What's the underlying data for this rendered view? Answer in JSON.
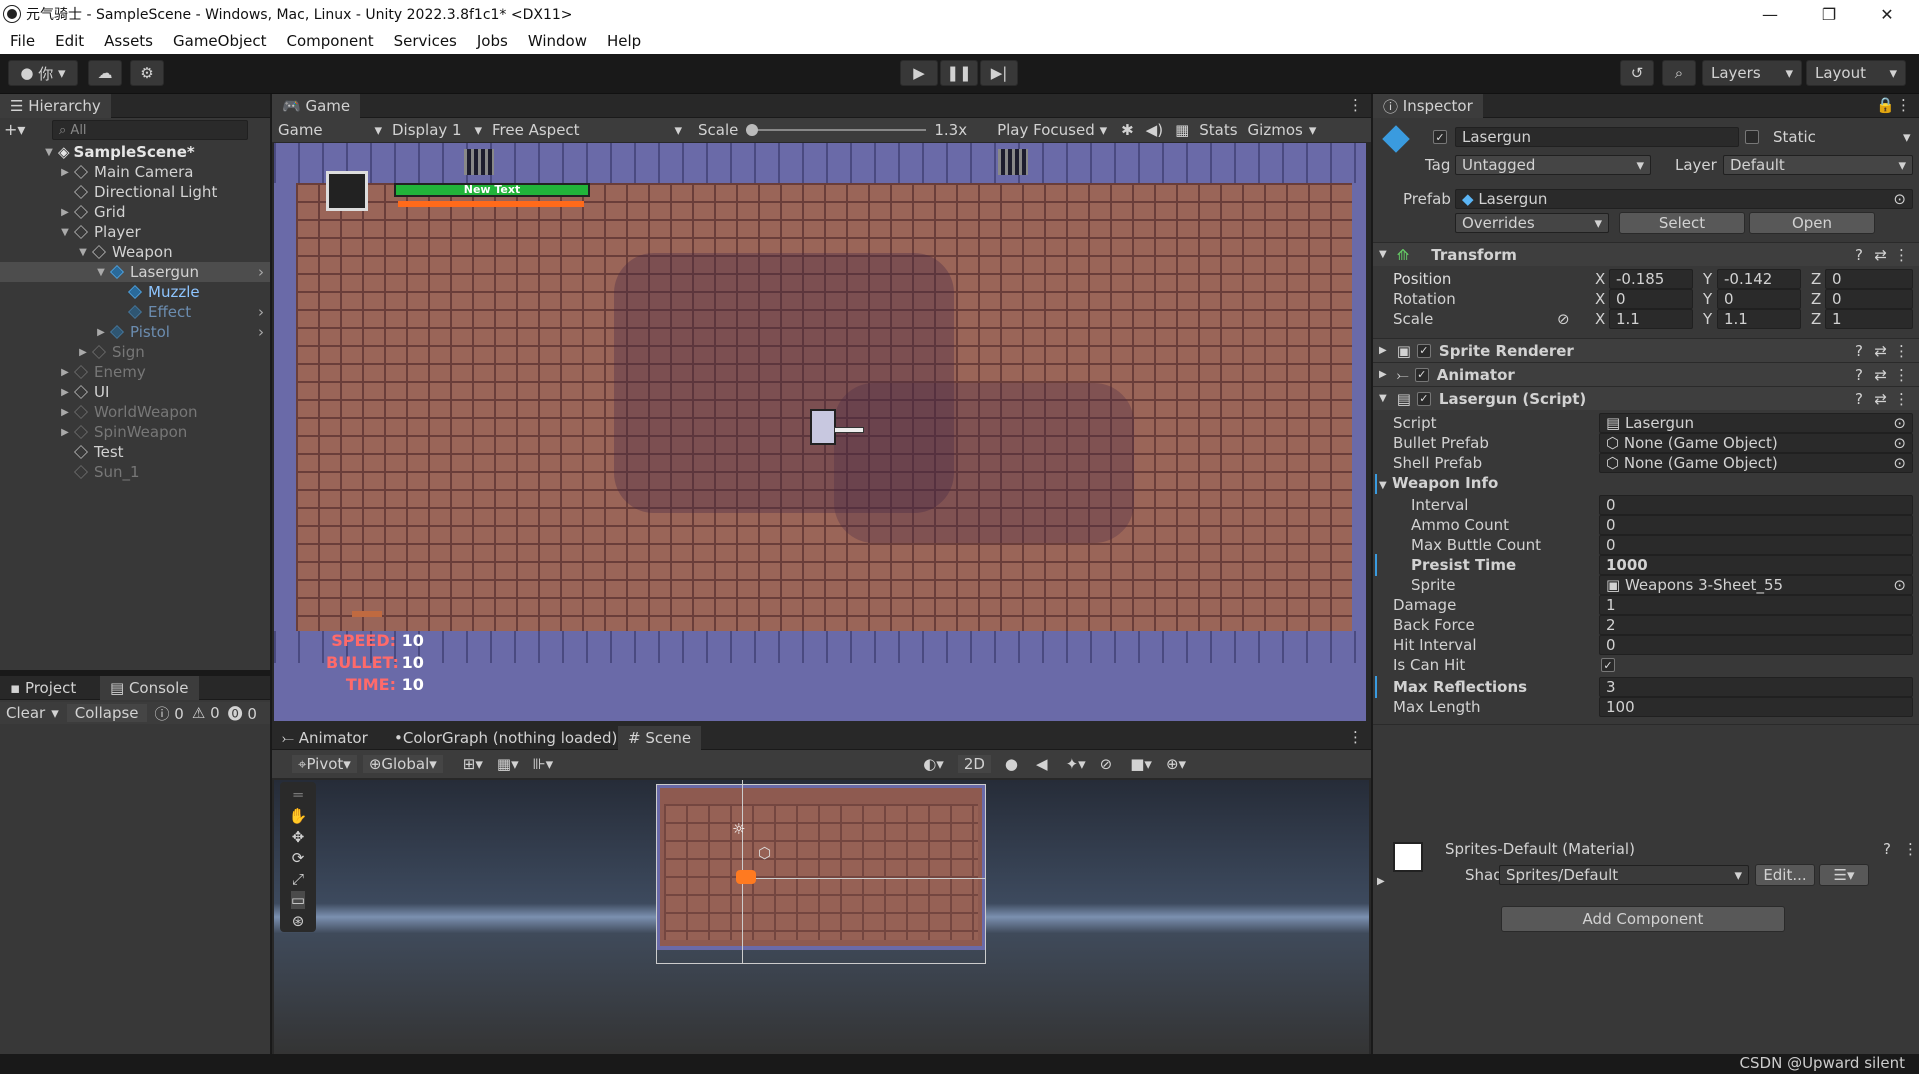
{
  "window": {
    "title": "元气骑士 - SampleScene - Windows, Mac, Linux - Unity 2022.3.8f1c1* <DX11>",
    "min": "—",
    "max": "❐",
    "close": "✕"
  },
  "menu": [
    "File",
    "Edit",
    "Assets",
    "GameObject",
    "Component",
    "Services",
    "Jobs",
    "Window",
    "Help"
  ],
  "toolbar": {
    "account": "你",
    "layers": "Layers",
    "layout": "Layout"
  },
  "hierarchy": {
    "tab": "Hierarchy",
    "search_placeholder": "All",
    "items": [
      {
        "label": "SampleScene*"
      },
      {
        "label": "Main Camera"
      },
      {
        "label": "Directional Light"
      },
      {
        "label": "Grid"
      },
      {
        "label": "Player"
      },
      {
        "label": "Weapon"
      },
      {
        "label": "Lasergun"
      },
      {
        "label": "Muzzle"
      },
      {
        "label": "Effect"
      },
      {
        "label": "Pistol"
      },
      {
        "label": "Sign"
      },
      {
        "label": "Enemy"
      },
      {
        "label": "UI"
      },
      {
        "label": "WorldWeapon"
      },
      {
        "label": "SpinWeapon"
      },
      {
        "label": "Test"
      },
      {
        "label": "Sun_1"
      }
    ]
  },
  "project": {
    "tab_project": "Project",
    "tab_console": "Console",
    "clear": "Clear",
    "collapse": "Collapse",
    "c1": "0",
    "c2": "0",
    "c3": "0"
  },
  "game": {
    "tab": "Game",
    "display_mode": "Game",
    "display": "Display 1",
    "aspect": "Free Aspect",
    "scale_label": "Scale",
    "scale_value": "1.3x",
    "play_mode": "Play Focused",
    "stats": "Stats",
    "gizmos": "Gizmos",
    "hud_text": "New Text",
    "speed_label": "SPEED:",
    "speed_value": "10",
    "bullet_label": "BULLET:",
    "bullet_value": "10",
    "time_label": "TIME:",
    "time_value": "10"
  },
  "scene": {
    "tab_animator": "Animator",
    "tab_colorgraph": "ColorGraph (nothing loaded)",
    "tab_scene": "Scene",
    "pivot": "Pivot",
    "global": "Global",
    "mode_2d": "2D"
  },
  "inspector": {
    "tab": "Inspector",
    "name": "Lasergun",
    "static": "Static",
    "tag_label": "Tag",
    "tag": "Untagged",
    "layer_label": "Layer",
    "layer": "Default",
    "prefab_label": "Prefab",
    "prefab": "Lasergun",
    "overrides": "Overrides",
    "select": "Select",
    "open": "Open",
    "transform": {
      "title": "Transform",
      "position": "Position",
      "rotation": "Rotation",
      "scale": "Scale",
      "px": "-0.185",
      "py": "-0.142",
      "pz": "0",
      "rx": "0",
      "ry": "0",
      "rz": "0",
      "sx": "1.1",
      "sy": "1.1",
      "sz": "1",
      "X": "X",
      "Y": "Y",
      "Z": "Z"
    },
    "sprite_renderer": "Sprite Renderer",
    "animator": "Animator",
    "script_comp": "Lasergun (Script)",
    "fields": {
      "script_l": "Script",
      "script_v": "Lasergun",
      "bullet_l": "Bullet Prefab",
      "bullet_v": "None (Game Object)",
      "shell_l": "Shell Prefab",
      "shell_v": "None (Game Object)",
      "weapon_info": "Weapon Info",
      "interval_l": "Interval",
      "interval_v": "0",
      "ammo_l": "Ammo Count",
      "ammo_v": "0",
      "maxb_l": "Max Buttle Count",
      "maxb_v": "0",
      "presist_l": "Presist Time",
      "presist_v": "1000",
      "sprite_l": "Sprite",
      "sprite_v": "Weapons 3-Sheet_55",
      "damage_l": "Damage",
      "damage_v": "1",
      "back_l": "Back Force",
      "back_v": "2",
      "hit_l": "Hit Interval",
      "hit_v": "0",
      "canhit_l": "Is Can Hit",
      "maxr_l": "Max Reflections",
      "maxr_v": "3",
      "maxlen_l": "Max Length",
      "maxlen_v": "100"
    },
    "material": "Sprites-Default (Material)",
    "shader_label": "Shader",
    "shader": "Sprites/Default",
    "edit": "Edit...",
    "add_component": "Add Component"
  },
  "watermark": "CSDN @Upward silent"
}
